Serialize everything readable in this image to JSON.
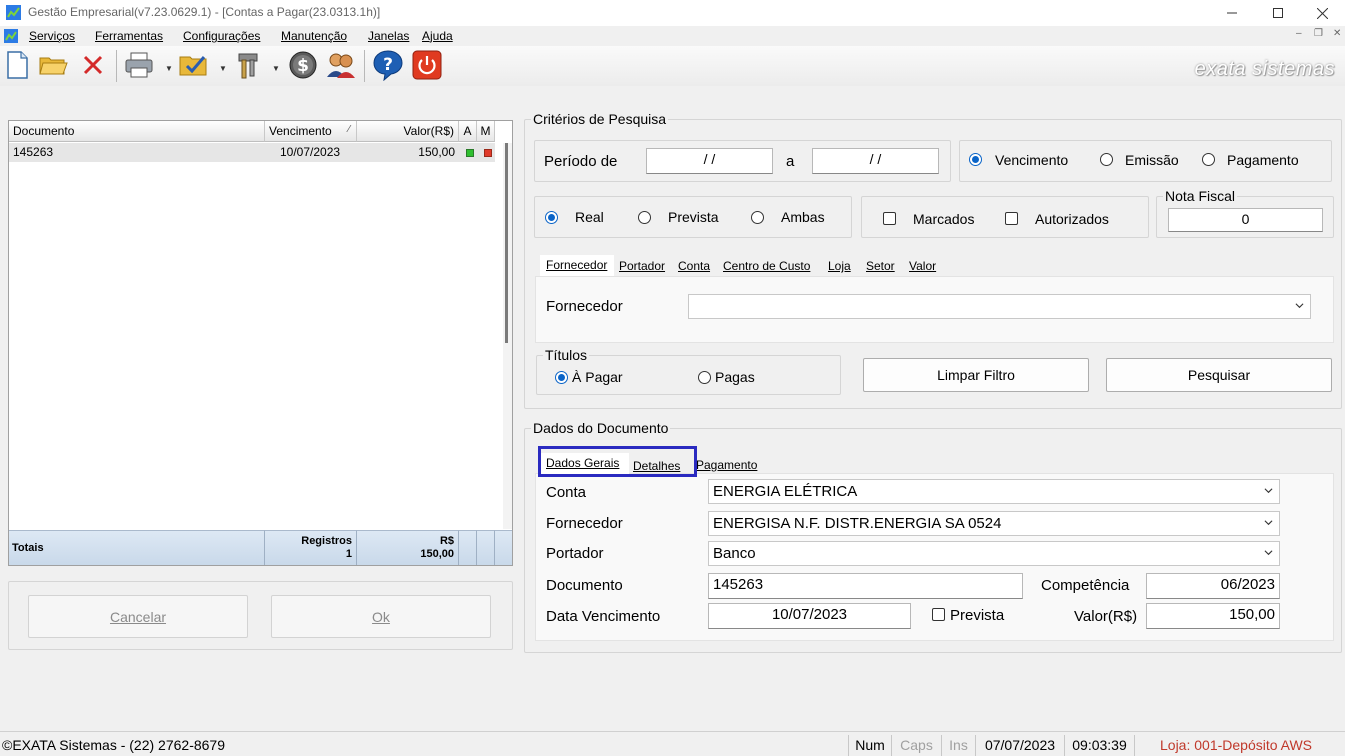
{
  "window": {
    "title": "Gestão Empresarial(v7.23.0629.1) - [Contas a Pagar(23.0313.1h)]",
    "controls": [
      "minimize",
      "maximize",
      "close"
    ]
  },
  "menu": {
    "items": [
      "Serviços",
      "Ferramentas",
      "Configurações",
      "Manutenção",
      "Janelas",
      "Ajuda"
    ]
  },
  "toolbar": {
    "buttons": [
      "new-document",
      "open-folder",
      "delete",
      "print",
      "checklist",
      "tools",
      "money",
      "users",
      "help",
      "power"
    ],
    "brand": "exata sistemas"
  },
  "grid": {
    "columns": [
      "Documento",
      "Vencimento",
      "Valor(R$)",
      "A",
      "M"
    ],
    "sort_indicator": "⁄",
    "rows": [
      {
        "documento": "145263",
        "vencimento": "10/07/2023",
        "valor": "150,00",
        "a_color": "#2fbf2f",
        "m_color": "#e03a2a"
      }
    ],
    "footer": {
      "label": "Totais",
      "registros_label": "Registros",
      "registros_value": "1",
      "currency_label": "R$",
      "total_value": "150,00"
    }
  },
  "actions": {
    "cancel": "Cancelar",
    "ok": "Ok"
  },
  "search": {
    "title": "Critérios de Pesquisa",
    "period_label": "Período de",
    "period_from": " /  /",
    "period_sep": "a",
    "period_to": " /  /",
    "date_type": {
      "options": [
        "Vencimento",
        "Emissão",
        "Pagamento"
      ],
      "selected": "Vencimento"
    },
    "kind": {
      "options": [
        "Real",
        "Prevista",
        "Ambas"
      ],
      "selected": "Real"
    },
    "marcados_label": "Marcados",
    "autorizados_label": "Autorizados",
    "nota_fiscal_label": "Nota Fiscal",
    "nota_fiscal_value": "0",
    "tabs": [
      "Fornecedor",
      "Portador",
      "Conta",
      "Centro de Custo",
      "Loja",
      "Setor",
      "Valor"
    ],
    "active_tab": "Fornecedor",
    "fornecedor_label": "Fornecedor",
    "fornecedor_value": "",
    "titulos_label": "Títulos",
    "titulos": {
      "options": [
        "À Pagar",
        "Pagas"
      ],
      "selected": "À Pagar"
    },
    "clear_button": "Limpar Filtro",
    "search_button": "Pesquisar"
  },
  "document": {
    "title": "Dados do Documento",
    "tabs": [
      "Dados Gerais",
      "Detalhes",
      "Pagamento"
    ],
    "active_tab": "Dados Gerais",
    "conta_label": "Conta",
    "conta_value": "ENERGIA ELÉTRICA",
    "fornecedor_label": "Fornecedor",
    "fornecedor_value": "ENERGISA N.F. DISTR.ENERGIA SA 0524",
    "portador_label": "Portador",
    "portador_value": "Banco",
    "documento_label": "Documento",
    "documento_value": "145263",
    "competencia_label": "Competência",
    "competencia_value": "06/2023",
    "vencimento_label": "Data Vencimento",
    "vencimento_value": "10/07/2023",
    "prevista_label": "Prevista",
    "valor_label": "Valor(R$)",
    "valor_value": "150,00",
    "highlight_color": "#2a2ac0"
  },
  "status": {
    "company": "©EXATA Sistemas - (22) 2762-8679",
    "num": "Num",
    "caps": "Caps",
    "ins": "Ins",
    "date": "07/07/2023",
    "time": "09:03:39",
    "store": "Loja: 001-Depósito AWS",
    "store_color": "#c0392b"
  }
}
